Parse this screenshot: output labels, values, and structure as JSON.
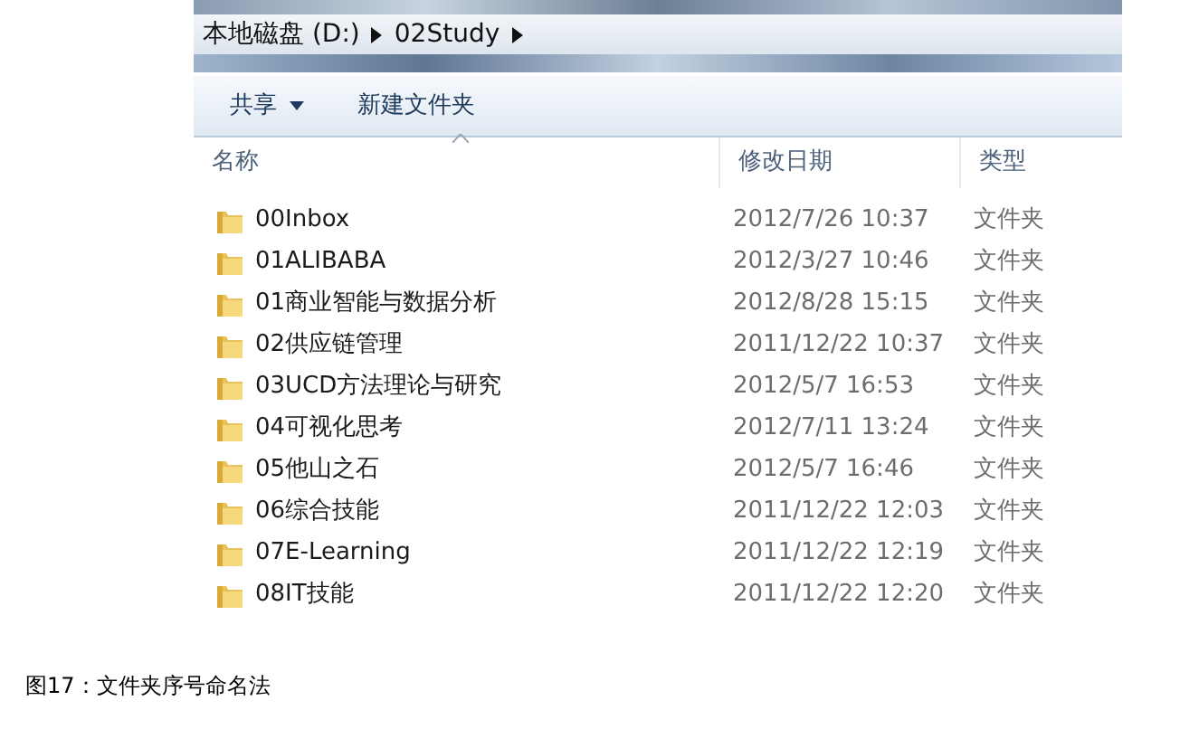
{
  "breadcrumb": [
    "本地磁盘 (D:)",
    "02Study"
  ],
  "toolbar": {
    "share": "共享",
    "new_folder": "新建文件夹"
  },
  "table": {
    "columns": [
      "名称",
      "修改日期",
      "类型"
    ],
    "rows": [
      {
        "name": "00Inbox",
        "modified": "2012/7/26 10:37",
        "type": "文件夹"
      },
      {
        "name": "01ALIBABA",
        "modified": "2012/3/27 10:46",
        "type": "文件夹"
      },
      {
        "name": "01商业智能与数据分析",
        "modified": "2012/8/28 15:15",
        "type": "文件夹"
      },
      {
        "name": "02供应链管理",
        "modified": "2011/12/22 10:37",
        "type": "文件夹"
      },
      {
        "name": "03UCD方法理论与研究",
        "modified": "2012/5/7 16:53",
        "type": "文件夹"
      },
      {
        "name": "04可视化思考",
        "modified": "2012/7/11 13:24",
        "type": "文件夹"
      },
      {
        "name": "05他山之石",
        "modified": "2012/5/7 16:46",
        "type": "文件夹"
      },
      {
        "name": "06综合技能",
        "modified": "2011/12/22 12:03",
        "type": "文件夹"
      },
      {
        "name": "07E-Learning",
        "modified": "2011/12/22 12:19",
        "type": "文件夹"
      },
      {
        "name": "08IT技能",
        "modified": "2011/12/22 12:20",
        "type": "文件夹"
      }
    ]
  },
  "caption": "图17：文件夹序号命名法"
}
